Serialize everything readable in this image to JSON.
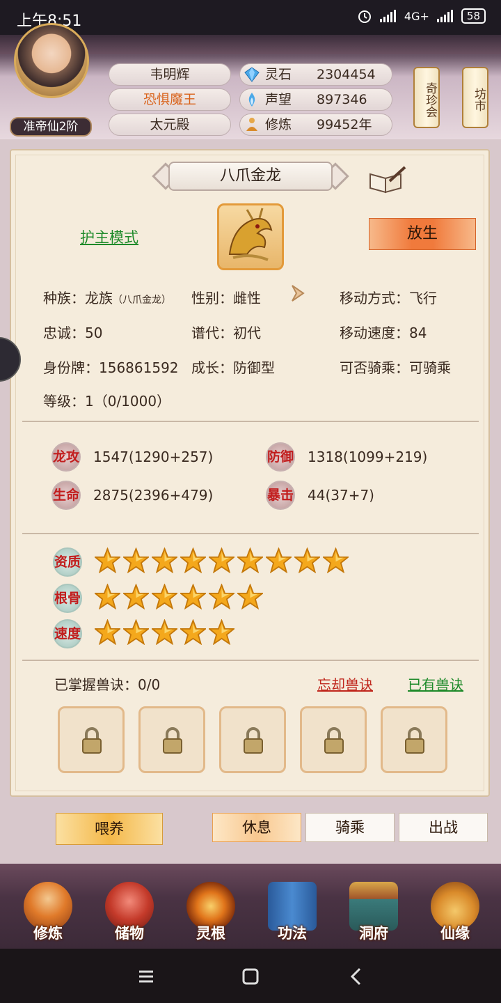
{
  "status_bar": {
    "time": "上午8:51",
    "network": "4G+",
    "battery": "58"
  },
  "player": {
    "realm": "准帝仙2阶",
    "name": "韦明辉",
    "title": "恐惧魔王",
    "sect": "太元殿",
    "resources": [
      {
        "label": "灵石",
        "value": "2304454",
        "icon": "gem-icon"
      },
      {
        "label": "声望",
        "value": "897346",
        "icon": "flame-icon"
      },
      {
        "label": "修炼",
        "value": "99452年",
        "icon": "meditation-icon"
      }
    ],
    "scrolls": [
      "奇珍会",
      "坊市"
    ]
  },
  "pet": {
    "name": "八爪金龙",
    "mode_link": "护主模式",
    "release_button": "放生",
    "attributes": {
      "race_label": "种族：",
      "race": "龙族",
      "race_detail": "（八爪金龙）",
      "gender_label": "性别：",
      "gender": "雌性",
      "move_label": "移动方式：",
      "move": "飞行",
      "loyalty_label": "忠诚：",
      "loyalty": "50",
      "gen_label": "谱代：",
      "gen": "初代",
      "speed_label": "移动速度：",
      "speed": "84",
      "id_label": "身份牌：",
      "id": "156861592",
      "growth_label": "成长：",
      "growth": "防御型",
      "ride_label": "可否骑乘：",
      "ride": "可骑乘",
      "level_label": "等级：",
      "level": "1（0/1000）"
    },
    "stats": [
      {
        "badge": "龙攻",
        "value": "1547(1290+257)"
      },
      {
        "badge": "防御",
        "value": "1318(1099+219)"
      },
      {
        "badge": "生命",
        "value": "2875(2396+479)"
      },
      {
        "badge": "暴击",
        "value": "44(37+7)"
      }
    ],
    "qualities": [
      {
        "badge": "资质",
        "stars": 9
      },
      {
        "badge": "根骨",
        "stars": 6
      },
      {
        "badge": "速度",
        "stars": 5
      }
    ],
    "skills": {
      "mastered": "已掌握兽诀：0/0",
      "forget_link": "忘却兽诀",
      "have_link": "已有兽诀",
      "slots": 5
    },
    "actions": {
      "feed": "喂养",
      "rest": "休息",
      "ride": "骑乘",
      "battle": "出战",
      "active": "rest"
    }
  },
  "bottom_nav": [
    "修炼",
    "储物",
    "灵根",
    "功法",
    "洞府",
    "仙缘"
  ],
  "colors": {
    "accent_orange": "#f07a3c",
    "link_green": "#1e8a2a",
    "link_red": "#c0271d",
    "star_gold": "#f4a81c"
  }
}
